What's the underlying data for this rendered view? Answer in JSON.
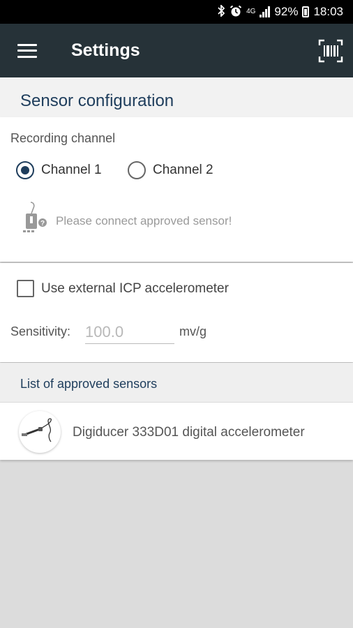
{
  "status_bar": {
    "battery": "92%",
    "time": "18:03",
    "icons": [
      "bluetooth-icon",
      "alarm-icon",
      "lte-icon",
      "signal-icon",
      "battery-icon"
    ]
  },
  "app_bar": {
    "title": "Settings",
    "menu_icon": "hamburger-menu-icon",
    "action_icon": "barcode-scan-icon",
    "background": "#263238"
  },
  "sensor_configuration": {
    "header": "Sensor configuration",
    "recording_channel": {
      "label": "Recording channel",
      "options": [
        {
          "label": "Channel 1",
          "selected": true
        },
        {
          "label": "Channel 2",
          "selected": false
        }
      ]
    },
    "hint": "Please connect approved sensor!",
    "external_icp": {
      "label": "Use external ICP accelerometer",
      "checked": false
    },
    "sensitivity": {
      "label": "Sensitivity:",
      "placeholder": "100.0",
      "unit": "mv/g"
    }
  },
  "approved_sensors": {
    "header": "List of approved sensors",
    "items": [
      {
        "name": "Digiducer 333D01 digital accelerometer",
        "icon": "accelerometer-cable-icon"
      }
    ]
  },
  "colors": {
    "accent": "#1e3d5c",
    "background": "#dcdcdc"
  }
}
